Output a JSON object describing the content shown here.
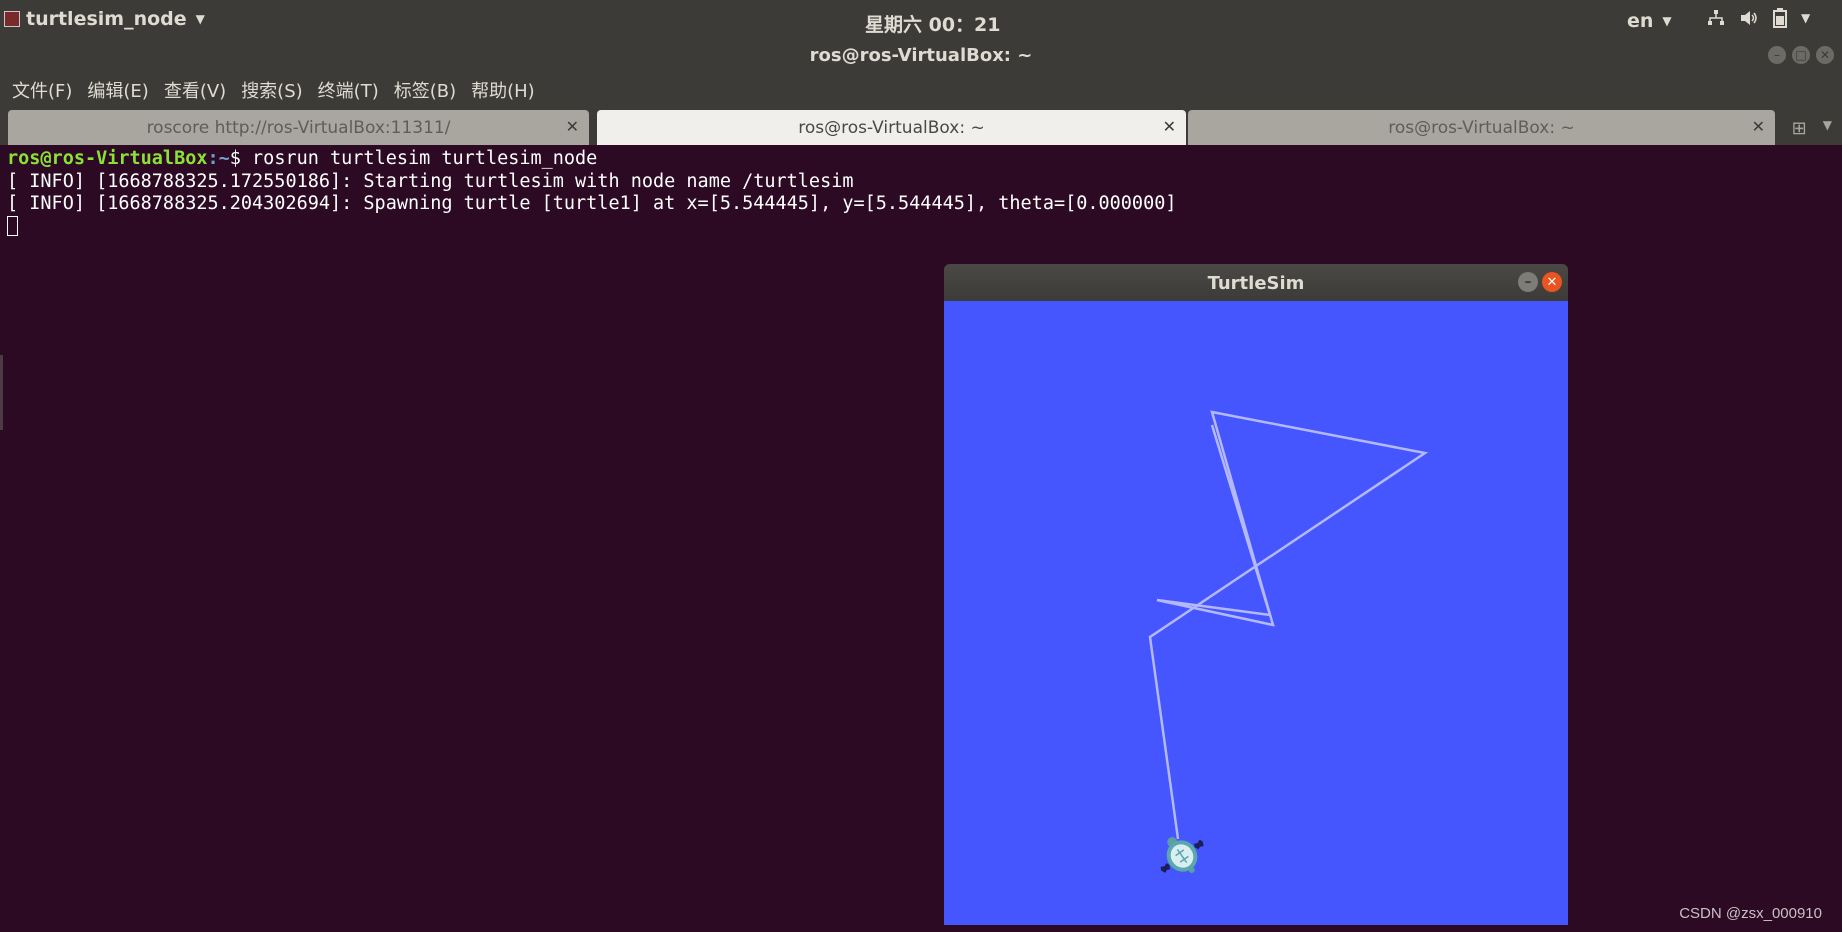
{
  "top_panel": {
    "app_name": "turtlesim_node",
    "clock": "星期六 00：21",
    "language": "en",
    "icons": [
      "network-icon",
      "volume-icon",
      "battery-icon",
      "system-menu-icon"
    ]
  },
  "window": {
    "title": "ros@ros-VirtualBox: ~"
  },
  "menu": {
    "items": [
      "文件(F)",
      "编辑(E)",
      "查看(V)",
      "搜索(S)",
      "终端(T)",
      "标签(B)",
      "帮助(H)"
    ]
  },
  "tabs": [
    {
      "label": "roscore http://ros-VirtualBox:11311/",
      "active": false
    },
    {
      "label": "ros@ros-VirtualBox: ~",
      "active": true
    },
    {
      "label": "ros@ros-VirtualBox: ~",
      "active": false
    }
  ],
  "terminal": {
    "prompt_user": "ros@ros-VirtualBox",
    "prompt_path": ":~",
    "prompt_symbol": "$ ",
    "command": "rosrun turtlesim turtlesim_node",
    "output": [
      "[ INFO] [1668788325.172550186]: Starting turtlesim with node name /turtlesim",
      "[ INFO] [1668788325.204302694]: Spawning turtle [turtle1] at x=[5.544445], y=[5.544445], theta=[0.000000]"
    ]
  },
  "turtlesim": {
    "title": "TurtleSim",
    "background_color": "#4556ff",
    "path_color": "#b3b8ff"
  },
  "watermark": "CSDN @zsx_000910",
  "colors": {
    "panel": "#3c3b37",
    "terminal_bg": "#2c0a24",
    "accent_close": "#e95420"
  }
}
